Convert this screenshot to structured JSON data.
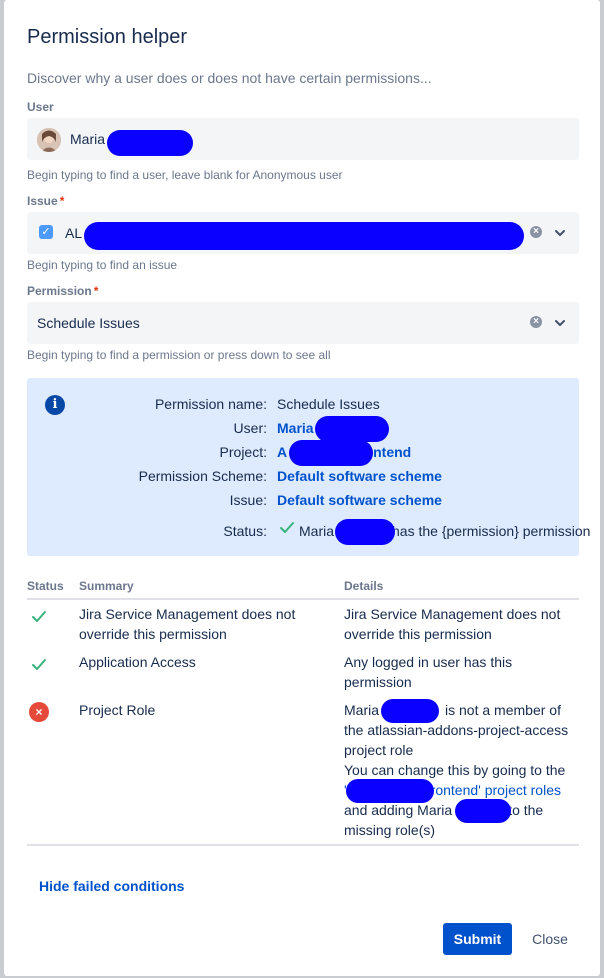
{
  "dialog": {
    "title": "Permission helper",
    "description": "Discover why a user does or does not have certain permissions..."
  },
  "user": {
    "label": "User",
    "value": "Maria",
    "help": "Begin typing to find a user, leave blank for Anonymous user"
  },
  "issue": {
    "label": "Issue",
    "required_mark": "*",
    "value": "AL",
    "help": "Begin typing to find an issue"
  },
  "permission": {
    "label": "Permission",
    "required_mark": "*",
    "value": "Schedule Issues",
    "help": "Begin typing to find a permission or press down to see all"
  },
  "info": {
    "icon": "info-icon",
    "rows": [
      {
        "key": "Permission name:",
        "value": "Schedule Issues"
      },
      {
        "key": "User:",
        "value": "Maria"
      },
      {
        "key": "Project:",
        "value_prefix": "A",
        "value_suffix": "rontend"
      },
      {
        "key": "Permission Scheme:",
        "value": "Default software scheme"
      },
      {
        "key": "Issue:",
        "value": "Default software scheme"
      },
      {
        "key": "Status:",
        "value_prefix": "Maria",
        "value_suffix": "has the {permission} permission"
      }
    ]
  },
  "conditions": {
    "headers": {
      "status": "Status",
      "summary": "Summary",
      "details": "Details"
    },
    "rows": [
      {
        "status": "pass",
        "summary": [
          "Jira Service Management does not",
          "override this permission"
        ],
        "details": [
          "Jira Service Management does not",
          "override this permission"
        ]
      },
      {
        "status": "pass",
        "summary": [
          "Application Access"
        ],
        "details": [
          "Any logged in user has this",
          "permission"
        ]
      },
      {
        "status": "fail",
        "summary": [
          "Project Role"
        ],
        "details_line1_prefix": "Maria",
        "details_line1_suffix": "is not a member of",
        "details_line2": "the atlassian-addons-project-access",
        "details_line3": "project role",
        "details_line4": "You can change this by going to the",
        "details_link_prefix": "'",
        "details_link_suffix": "rontend' project roles",
        "details_line6_prefix": "and adding Maria",
        "details_line6_suffix": "to the",
        "details_line7": "missing role(s)"
      }
    ]
  },
  "footer": {
    "toggle_link": "Hide failed conditions",
    "submit": "Submit",
    "close": "Close"
  },
  "colors": {
    "primary": "#0052cc",
    "info_bg": "#deebff",
    "success": "#36b37e",
    "error": "#e5493a",
    "redaction": "#0a00ff"
  }
}
